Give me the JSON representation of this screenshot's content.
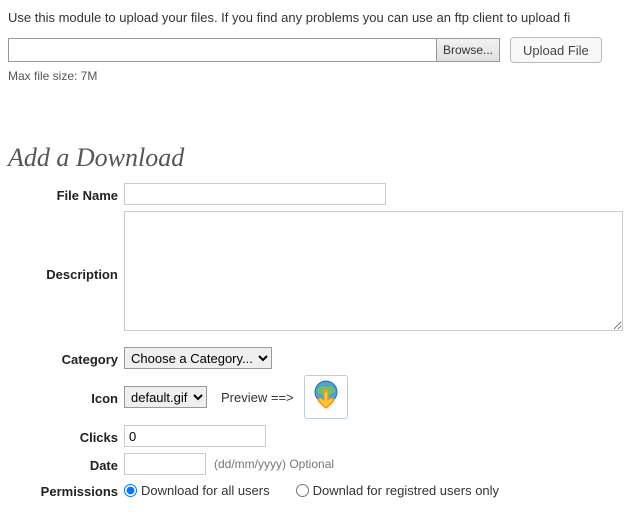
{
  "upload": {
    "instruction": "Use this module to upload your files. If you find any problems you can use an ftp client to upload fi",
    "browse_label": "Browse...",
    "upload_label": "Upload File",
    "max_size": "Max file size: 7M"
  },
  "section_title": "Add a Download",
  "form": {
    "file_name": {
      "label": "File Name",
      "value": ""
    },
    "description": {
      "label": "Description",
      "value": ""
    },
    "category": {
      "label": "Category",
      "selected": "Choose a Category...",
      "options": [
        "Choose a Category..."
      ]
    },
    "icon": {
      "label": "Icon",
      "selected": "default.gif",
      "options": [
        "default.gif"
      ],
      "preview_label": "Preview ==>"
    },
    "clicks": {
      "label": "Clicks",
      "value": "0"
    },
    "date": {
      "label": "Date",
      "value": "",
      "hint": "(dd/mm/yyyy) Optional"
    },
    "permissions": {
      "label": "Permissions",
      "option_all": "Download for all users",
      "option_reg": "Downlad for registred users only",
      "selected": "all"
    }
  }
}
